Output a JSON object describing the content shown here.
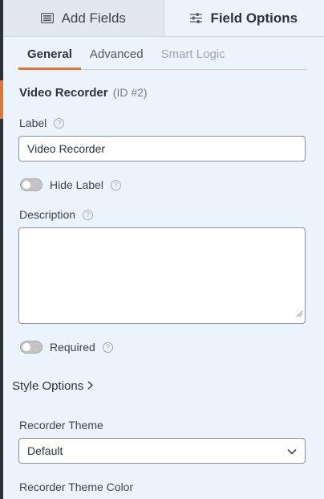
{
  "tabs": {
    "add_fields": "Add Fields",
    "field_options": "Field Options"
  },
  "sub_tabs": {
    "general": "General",
    "advanced": "Advanced",
    "smart_logic": "Smart Logic"
  },
  "field": {
    "name": "Video Recorder",
    "id_text": "(ID #2)"
  },
  "label_section": {
    "label": "Label",
    "value": "Video Recorder"
  },
  "hide_label": {
    "label": "Hide Label",
    "checked": false
  },
  "description": {
    "label": "Description",
    "value": ""
  },
  "required": {
    "label": "Required",
    "checked": false
  },
  "style_options": {
    "label": "Style Options"
  },
  "recorder_theme": {
    "label": "Recorder Theme",
    "selected": "Default"
  },
  "recorder_theme_color": {
    "label": "Recorder Theme Color"
  },
  "colors": {
    "accent": "#e27730",
    "panel_bg": "#ebf3fc"
  },
  "icons": {
    "add_fields": "table-list-icon",
    "field_options": "sliders-icon",
    "help": "question-circle-icon",
    "chevron": "chevron-right-icon",
    "dropdown": "chevron-down-icon"
  }
}
